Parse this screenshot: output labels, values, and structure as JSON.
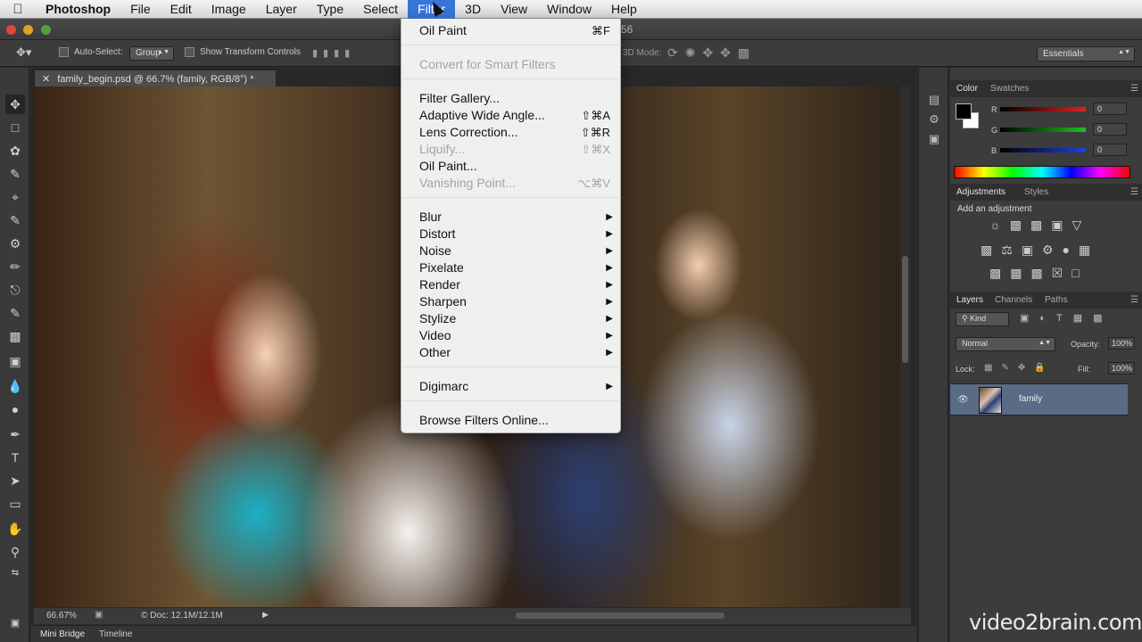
{
  "menubar": {
    "app_name": "Photoshop",
    "items": [
      "File",
      "Edit",
      "Image",
      "Layer",
      "Type",
      "Select",
      "Filter",
      "3D",
      "View",
      "Window",
      "Help"
    ],
    "active": "Filter"
  },
  "titlebar": {
    "partial_text": "56"
  },
  "options_bar": {
    "auto_select_label": "Auto-Select:",
    "auto_select_value": "Group",
    "show_transform_label": "Show Transform Controls",
    "mode_3d_label": "3D Mode:",
    "workspace": "Essentials"
  },
  "document": {
    "tab_title": "family_begin.psd @ 66.7% (family, RGB/8°) *",
    "zoom": "66.67%",
    "doc_size": "Doc: 12.1M/12.1M",
    "doc_prefix": "©"
  },
  "bottom_tabs": [
    "Mini Bridge",
    "Timeline"
  ],
  "filter_menu": {
    "items": [
      {
        "label": "Oil Paint",
        "shortcut": "⌘F",
        "disabled": false,
        "submenu": false
      },
      {
        "label": "Convert for Smart Filters",
        "shortcut": "",
        "disabled": true,
        "submenu": false
      },
      {
        "label": "Filter Gallery...",
        "shortcut": "",
        "disabled": false,
        "submenu": false
      },
      {
        "label": "Adaptive Wide Angle...",
        "shortcut": "⇧⌘A",
        "disabled": false,
        "submenu": false
      },
      {
        "label": "Lens Correction...",
        "shortcut": "⇧⌘R",
        "disabled": false,
        "submenu": false
      },
      {
        "label": "Liquify...",
        "shortcut": "⇧⌘X",
        "disabled": true,
        "submenu": false
      },
      {
        "label": "Oil Paint...",
        "shortcut": "",
        "disabled": false,
        "submenu": false
      },
      {
        "label": "Vanishing Point...",
        "shortcut": "⌥⌘V",
        "disabled": true,
        "submenu": false
      },
      {
        "label": "Blur",
        "shortcut": "",
        "disabled": false,
        "submenu": true
      },
      {
        "label": "Distort",
        "shortcut": "",
        "disabled": false,
        "submenu": true
      },
      {
        "label": "Noise",
        "shortcut": "",
        "disabled": false,
        "submenu": true
      },
      {
        "label": "Pixelate",
        "shortcut": "",
        "disabled": false,
        "submenu": true
      },
      {
        "label": "Render",
        "shortcut": "",
        "disabled": false,
        "submenu": true
      },
      {
        "label": "Sharpen",
        "shortcut": "",
        "disabled": false,
        "submenu": true
      },
      {
        "label": "Stylize",
        "shortcut": "",
        "disabled": false,
        "submenu": true
      },
      {
        "label": "Video",
        "shortcut": "",
        "disabled": false,
        "submenu": true
      },
      {
        "label": "Other",
        "shortcut": "",
        "disabled": false,
        "submenu": true
      },
      {
        "label": "Digimarc",
        "shortcut": "",
        "disabled": false,
        "submenu": true
      },
      {
        "label": "Browse Filters Online...",
        "shortcut": "",
        "disabled": false,
        "submenu": false
      }
    ],
    "submenu_arrow": "▶"
  },
  "color_panel": {
    "tabs": [
      "Color",
      "Swatches"
    ],
    "channels": [
      {
        "label": "R",
        "value": "0",
        "color": "#e02020"
      },
      {
        "label": "G",
        "value": "0",
        "color": "#20c020"
      },
      {
        "label": "B",
        "value": "0",
        "color": "#2040e0"
      }
    ]
  },
  "adjustments_panel": {
    "tabs": [
      "Adjustments",
      "Styles"
    ],
    "title": "Add an adjustment"
  },
  "layers_panel": {
    "tabs": [
      "Layers",
      "Channels",
      "Paths"
    ],
    "kind": "Kind",
    "blend_mode": "Normal",
    "opacity_label": "Opacity:",
    "opacity": "100%",
    "lock_label": "Lock:",
    "fill_label": "Fill:",
    "fill": "100%",
    "layer_name": "family"
  },
  "watermark": "video2brain.com",
  "colors": {
    "menu_highlight": "#3875d7",
    "layer_selected": "#5a6b85"
  }
}
